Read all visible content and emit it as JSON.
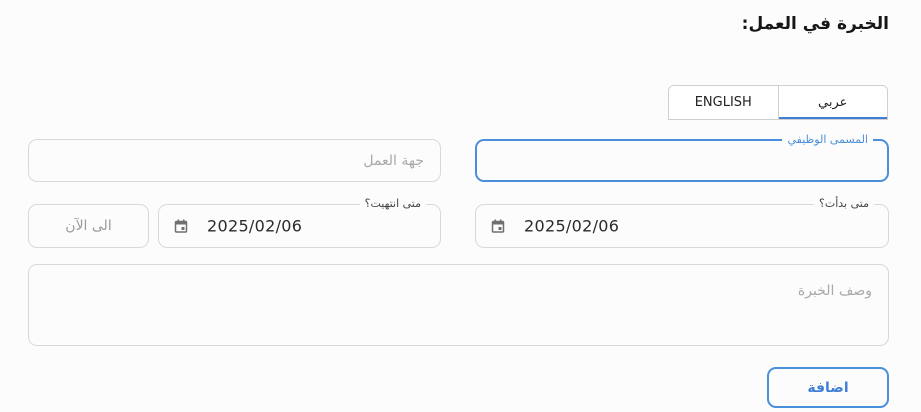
{
  "section": {
    "title": "الخبرة في العمل:"
  },
  "language_tabs": {
    "english": "ENGLISH",
    "arabic": "عربي",
    "active": "arabic"
  },
  "fields": {
    "job_title": {
      "label": "المسمى الوظيفي",
      "value": ""
    },
    "employer": {
      "placeholder": "جهة العمل"
    },
    "start_date": {
      "label": "متى بدأت؟",
      "value": "2025/02/06"
    },
    "end_date": {
      "label": "متى انتهيت؟",
      "value": "2025/02/06"
    },
    "present": {
      "label": "الى الآن"
    },
    "description": {
      "placeholder": "وصف الخبرة"
    }
  },
  "actions": {
    "add": "اضافة"
  },
  "colors": {
    "accent": "#4a8fdb",
    "border": "#d9d9d9",
    "placeholder": "#a9a9a9"
  },
  "icons": {
    "date": "calendar-icon"
  }
}
